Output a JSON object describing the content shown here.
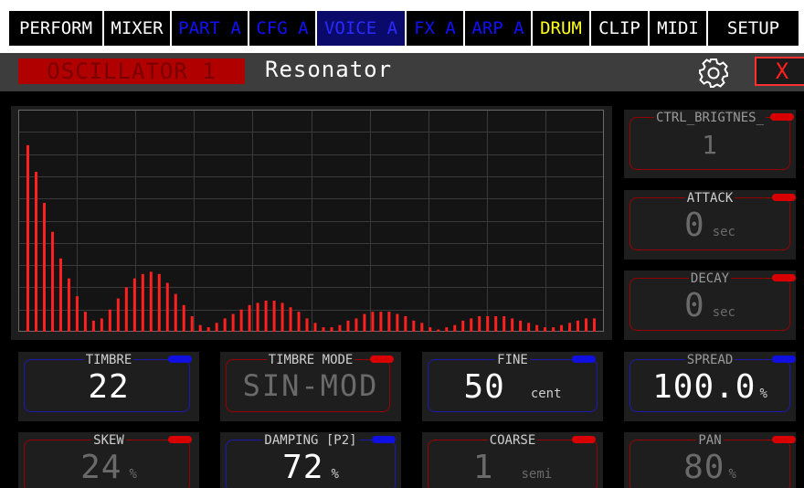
{
  "tabs": [
    {
      "label": "PERFORM",
      "style": "white"
    },
    {
      "label": "MIXER",
      "style": "white"
    },
    {
      "label": "PART A",
      "style": "blue"
    },
    {
      "label": "CFG A",
      "style": "blue"
    },
    {
      "label": "VOICE A",
      "style": "active"
    },
    {
      "label": "FX A",
      "style": "blue"
    },
    {
      "label": "ARP A",
      "style": "blue"
    },
    {
      "label": "DRUM",
      "style": "yellow"
    },
    {
      "label": "CLIP",
      "style": "white"
    },
    {
      "label": "MIDI",
      "style": "white"
    },
    {
      "label": "SETUP",
      "style": "white"
    }
  ],
  "header": {
    "oscillator_label": "OSCILLATOR 1",
    "preset_name": "Resonator",
    "close_label": "X"
  },
  "spectrum": {
    "bar_levels": [
      0.84,
      0.72,
      0.58,
      0.45,
      0.33,
      0.24,
      0.16,
      0.09,
      0.05,
      0.06,
      0.1,
      0.15,
      0.2,
      0.24,
      0.26,
      0.27,
      0.26,
      0.22,
      0.17,
      0.12,
      0.07,
      0.03,
      0.02,
      0.04,
      0.06,
      0.08,
      0.1,
      0.12,
      0.13,
      0.14,
      0.14,
      0.13,
      0.11,
      0.09,
      0.06,
      0.04,
      0.02,
      0.02,
      0.03,
      0.05,
      0.06,
      0.08,
      0.09,
      0.09,
      0.09,
      0.08,
      0.07,
      0.05,
      0.04,
      0.02,
      0.01,
      0.02,
      0.03,
      0.05,
      0.06,
      0.07,
      0.07,
      0.07,
      0.07,
      0.06,
      0.05,
      0.04,
      0.03,
      0.02,
      0.02,
      0.03,
      0.04,
      0.05,
      0.06,
      0.06
    ],
    "colors": {
      "bar": "#ff2020",
      "grid": "#3a3a3a",
      "border": "#6a6a6a"
    }
  },
  "params": {
    "ctrl_brightness": {
      "label": "CTRL_BRIGTNES_",
      "value": "1",
      "unit": ""
    },
    "attack": {
      "label": "ATTACK",
      "value": "0",
      "unit": "sec"
    },
    "decay": {
      "label": "DECAY",
      "value": "0",
      "unit": "sec"
    },
    "timbre": {
      "label": "TIMBRE",
      "value": "22",
      "unit": ""
    },
    "timbre_mode": {
      "label": "TIMBRE MODE",
      "value": "SIN-MOD",
      "unit": ""
    },
    "fine": {
      "label": "FINE",
      "value": "50",
      "unit": "cent"
    },
    "spread": {
      "label": "SPREAD",
      "value": "100.0",
      "unit": "%"
    },
    "skew": {
      "label": "SKEW",
      "value": "24",
      "unit": "%"
    },
    "damping": {
      "label": "DAMPING [P2]",
      "value": "72",
      "unit": "%"
    },
    "coarse": {
      "label": "COARSE",
      "value": "1",
      "unit": "semi"
    },
    "pan": {
      "label": "PAN",
      "value": "80",
      "unit": "%"
    }
  },
  "colors": {
    "accent_red": "#d80000",
    "accent_blue": "#1010e0",
    "tab_blue": "#1010ff",
    "tab_yellow": "#ffff20"
  }
}
